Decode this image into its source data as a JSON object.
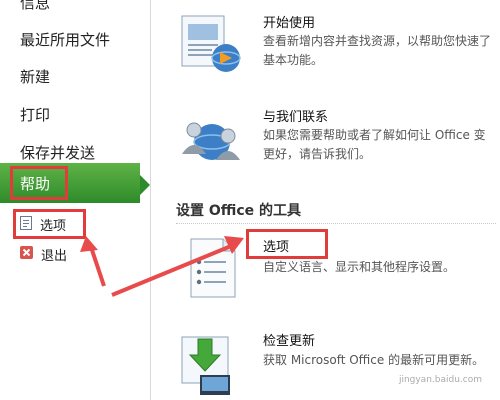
{
  "sidebar": {
    "items": [
      {
        "label": "信息"
      },
      {
        "label": "最近所用文件"
      },
      {
        "label": "新建"
      },
      {
        "label": "打印"
      },
      {
        "label": "保存并发送"
      }
    ],
    "help_label": "帮助",
    "sub_items": [
      {
        "label": "选项"
      },
      {
        "label": "退出"
      }
    ]
  },
  "main": {
    "entries": [
      {
        "title": "开始使用",
        "desc_line1": "查看新增内容并查找资源，以帮助您快速了",
        "desc_line2": "基本功能。"
      },
      {
        "title": "与我们联系",
        "desc_line1": "如果您需要帮助或者了解如何让 Office 变",
        "desc_line2": "更好，请告诉我们。"
      }
    ],
    "section_title": "设置 Office 的工具",
    "tools": [
      {
        "title": "选项",
        "desc": "自定义语言、显示和其他程序设置。"
      },
      {
        "title": "检查更新",
        "desc": "获取 Microsoft Office 的最新可用更新。"
      }
    ]
  },
  "watermark": "jingyan.baidu.com",
  "colors": {
    "accent_green": "#3a9a32",
    "highlight_red": "#e03c3c"
  }
}
